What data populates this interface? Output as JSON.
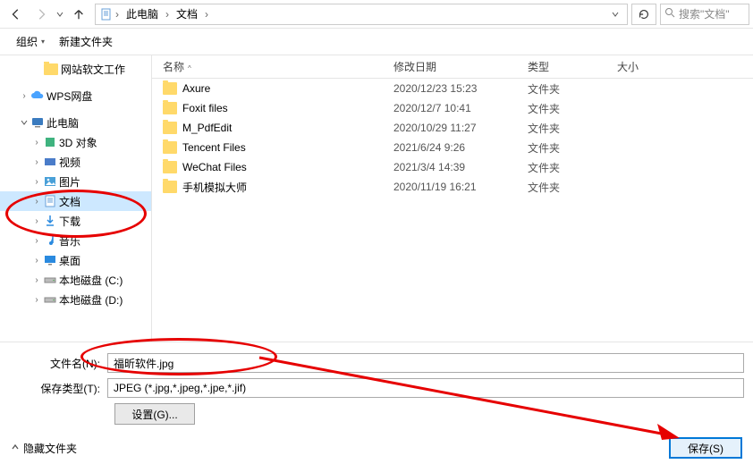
{
  "nav": {
    "crumb1": "此电脑",
    "crumb2": "文档"
  },
  "search": {
    "placeholder": "搜索\"文档\""
  },
  "toolbar": {
    "organize": "组织",
    "newfolder": "新建文件夹"
  },
  "sidebar": {
    "wangzhan": "网站软文工作",
    "wps": "WPS网盘",
    "thispc": "此电脑",
    "obj3d": "3D 对象",
    "video": "视频",
    "pictures": "图片",
    "documents": "文档",
    "downloads": "下载",
    "music": "音乐",
    "desktop": "桌面",
    "diskc": "本地磁盘 (C:)",
    "diskd": "本地磁盘 (D:)"
  },
  "columns": {
    "name": "名称",
    "date": "修改日期",
    "type": "类型",
    "size": "大小"
  },
  "files": [
    {
      "name": "Axure",
      "date": "2020/12/23 15:23",
      "type": "文件夹"
    },
    {
      "name": "Foxit files",
      "date": "2020/12/7 10:41",
      "type": "文件夹"
    },
    {
      "name": "M_PdfEdit",
      "date": "2020/10/29 11:27",
      "type": "文件夹"
    },
    {
      "name": "Tencent Files",
      "date": "2021/6/24 9:26",
      "type": "文件夹"
    },
    {
      "name": "WeChat Files",
      "date": "2021/3/4 14:39",
      "type": "文件夹"
    },
    {
      "name": "手机模拟大师",
      "date": "2020/11/19 16:21",
      "type": "文件夹"
    }
  ],
  "form": {
    "filename_label": "文件名(N):",
    "filename_value": "福昕软件.jpg",
    "savetype_label": "保存类型(T):",
    "savetype_value": "JPEG (*.jpg,*.jpeg,*.jpe,*.jif)",
    "settings": "设置(G)...",
    "hide_folders": "隐藏文件夹",
    "save": "保存(S)"
  }
}
